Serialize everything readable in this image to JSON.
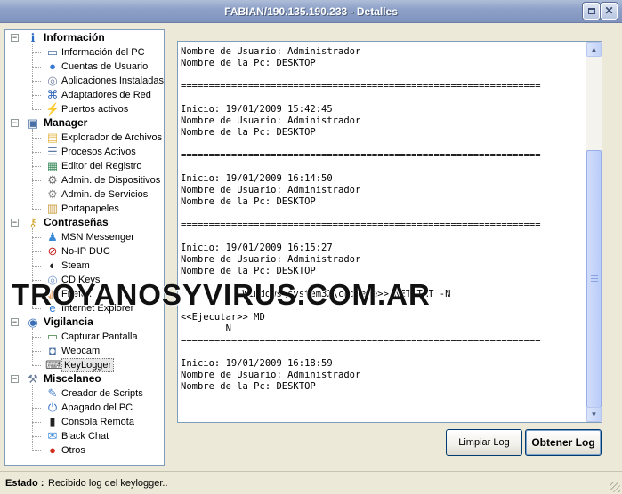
{
  "window": {
    "title": "FABIAN/190.135.190.233 - Detalles"
  },
  "tree": {
    "categories": [
      {
        "label": "Información",
        "icon": "info-icon",
        "items": [
          {
            "label": "Información del PC",
            "icon": "computer-icon"
          },
          {
            "label": "Cuentas de Usuario",
            "icon": "user-icon"
          },
          {
            "label": "Aplicaciones Instaladas",
            "icon": "cd-icon"
          },
          {
            "label": "Adaptadores de Red",
            "icon": "network-icon"
          },
          {
            "label": "Puertos activos",
            "icon": "plug-icon"
          }
        ]
      },
      {
        "label": "Manager",
        "icon": "monitor-icon",
        "items": [
          {
            "label": "Explorador de Archivos",
            "icon": "folder-search-icon"
          },
          {
            "label": "Procesos Activos",
            "icon": "process-list-icon"
          },
          {
            "label": "Editor del Registro",
            "icon": "registry-icon"
          },
          {
            "label": "Admin. de Dispositivos",
            "icon": "gear-device-icon"
          },
          {
            "label": "Admin. de Servicios",
            "icon": "services-gear-icon"
          },
          {
            "label": "Portapapeles",
            "icon": "clipboard-icon"
          }
        ]
      },
      {
        "label": "Contraseñas",
        "icon": "key-icon",
        "items": [
          {
            "label": "MSN Messenger",
            "icon": "msn-icon"
          },
          {
            "label": "No-IP DUC",
            "icon": "no-ip-icon"
          },
          {
            "label": "Steam",
            "icon": "steam-icon"
          },
          {
            "label": "CD Keys",
            "icon": "cd-key-icon"
          },
          {
            "label": "Firefox",
            "icon": "firefox-icon"
          },
          {
            "label": "Internet Explorer",
            "icon": "internet-explorer-icon"
          }
        ]
      },
      {
        "label": "Vigilancia",
        "icon": "eye-icon",
        "items": [
          {
            "label": "Capturar Pantalla",
            "icon": "screenshot-icon"
          },
          {
            "label": "Webcam",
            "icon": "webcam-icon"
          },
          {
            "label": "KeyLogger",
            "icon": "keyboard-icon",
            "selected": true
          }
        ]
      },
      {
        "label": "Miscelaneo",
        "icon": "wrench-icon",
        "items": [
          {
            "label": "Creador de Scripts",
            "icon": "script-icon"
          },
          {
            "label": "Apagado del PC",
            "icon": "shutdown-icon"
          },
          {
            "label": "Consola Remota",
            "icon": "console-icon"
          },
          {
            "label": "Black Chat",
            "icon": "chat-icon"
          },
          {
            "label": "Otros",
            "icon": "other-icon"
          }
        ]
      }
    ]
  },
  "log": {
    "lines": [
      "Nombre de Usuario: Administrador",
      "Nombre de la Pc: DESKTOP",
      "",
      "================================================================",
      "",
      "Inicio: 19/01/2009 15:42:45",
      "Nombre de Usuario: Administrador",
      "Nombre de la Pc: DESKTOP",
      "",
      "================================================================",
      "",
      "Inicio: 19/01/2009 16:14:50",
      "Nombre de Usuario: Administrador",
      "Nombre de la Pc: DESKTOP",
      "",
      "================================================================",
      "",
      "Inicio: 19/01/2009 16:15:27",
      "Nombre de Usuario: Administrador",
      "Nombre de la Pc: DESKTOP",
      "",
      "           Windows\\system32\\cmd.exe>> NETSTAT -N",
      "",
      "<<Ejecutar>> MD",
      "        N",
      "================================================================",
      "",
      "Inicio: 19/01/2009 16:18:59",
      "Nombre de Usuario: Administrador",
      "Nombre de la Pc: DESKTOP"
    ]
  },
  "watermark": "TROYANOSYVIRUS.COM.AR",
  "buttons": {
    "clear": "Limpiar Log",
    "fetch": "Obtener Log"
  },
  "status": {
    "label": "Estado :",
    "text": "Recibido log del keylogger.."
  }
}
